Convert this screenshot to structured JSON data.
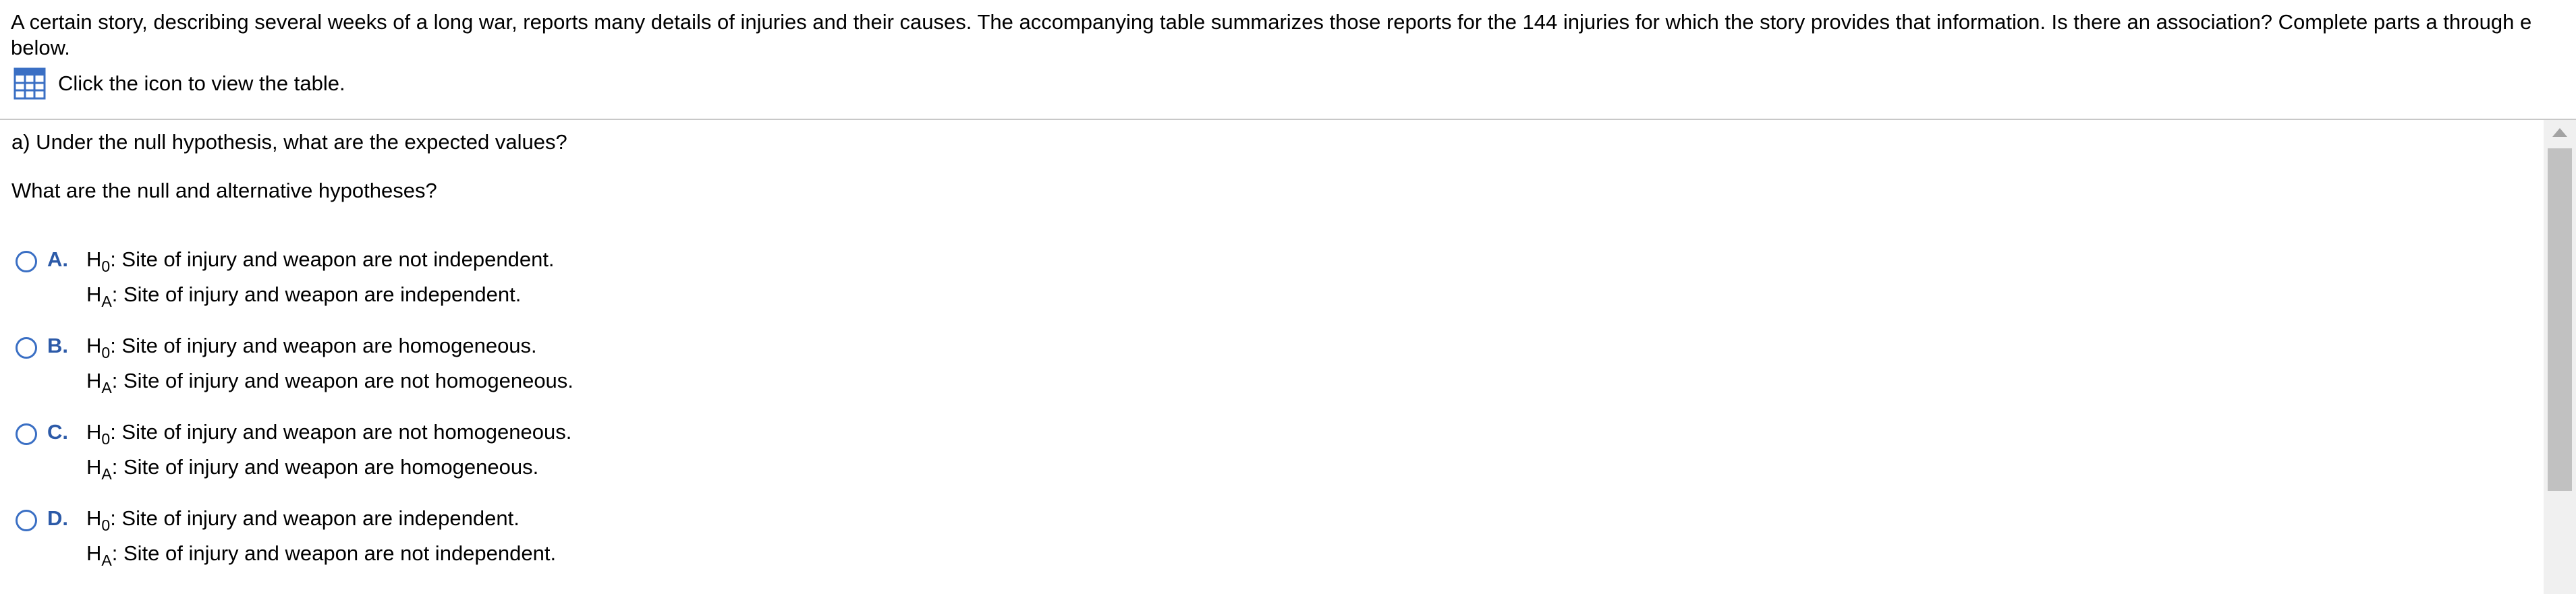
{
  "intro": {
    "text": "A certain story, describing several weeks of a long war, reports many details of injuries and their causes. The accompanying table summarizes those reports for the 144 injuries for which the story provides that information. Is there an association? Complete parts a through e below."
  },
  "table_link": {
    "icon": "table-grid-icon",
    "label": "Click the icon to view the table.",
    "icon_color": "#3a6fc4"
  },
  "question": {
    "part": "a) Under the null hypothesis, what are the expected values?",
    "prompt": "What are the null and alternative hypotheses?"
  },
  "options": [
    {
      "letter": "A.",
      "h0_symbol": "H",
      "h0_sub": "0",
      "h0_text": ": Site of injury and weapon are not independent.",
      "ha_symbol": "H",
      "ha_sub": "A",
      "ha_text": ": Site of injury and weapon are independent."
    },
    {
      "letter": "B.",
      "h0_symbol": "H",
      "h0_sub": "0",
      "h0_text": ": Site of injury and weapon are homogeneous.",
      "ha_symbol": "H",
      "ha_sub": "A",
      "ha_text": ": Site of injury and weapon are not homogeneous."
    },
    {
      "letter": "C.",
      "h0_symbol": "H",
      "h0_sub": "0",
      "h0_text": ": Site of injury and weapon are not homogeneous.",
      "ha_symbol": "H",
      "ha_sub": "A",
      "ha_text": ": Site of injury and weapon are homogeneous."
    },
    {
      "letter": "D.",
      "h0_symbol": "H",
      "h0_sub": "0",
      "h0_text": ": Site of injury and weapon are independent.",
      "ha_symbol": "H",
      "ha_sub": "A",
      "ha_text": ": Site of injury and weapon are not independent."
    }
  ],
  "colors": {
    "accent": "#2c5aa8",
    "radio_border": "#3a6fc4",
    "divider": "#c8c8c8",
    "scroll_track": "#f0f0f0",
    "scroll_thumb": "#c1c1c1"
  }
}
